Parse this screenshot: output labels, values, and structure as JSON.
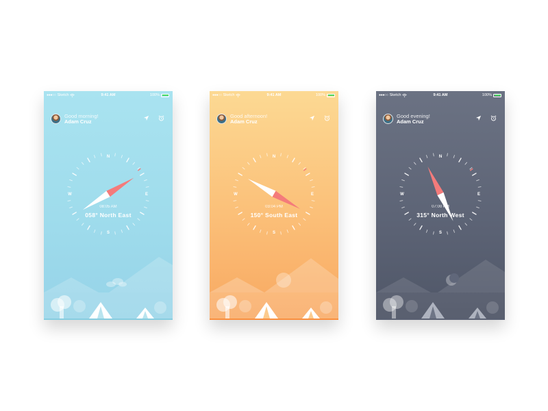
{
  "screens": [
    {
      "theme": "morning",
      "status": {
        "carrier": "Sketch",
        "time": "9:41 AM",
        "battery": "100%"
      },
      "greeting": "Good morning!",
      "user_name": "Adam Cruz",
      "compass": {
        "heading_deg": 58,
        "time": "08:05 AM",
        "heading_text": "058° North East",
        "cardinals": {
          "n": "N",
          "e": "E",
          "s": "S",
          "w": "W"
        }
      },
      "colors": {
        "needle": "#f47b7b",
        "sky_top": "#a9e3f0",
        "sky_bottom": "#96d3e8",
        "ground": "#7ec8dc"
      }
    },
    {
      "theme": "afternoon",
      "status": {
        "carrier": "Sketch",
        "time": "9:41 AM",
        "battery": "100%"
      },
      "greeting": "Good afternoon!",
      "user_name": "Adam Cruz",
      "compass": {
        "heading_deg": 120,
        "time": "03:04 PM",
        "heading_text": "150° South East",
        "cardinals": {
          "n": "N",
          "e": "E",
          "s": "S",
          "w": "W"
        }
      },
      "colors": {
        "needle": "#f47b7b",
        "sky_top": "#fcd993",
        "sky_bottom": "#f8a861",
        "ground": "#fa8f3e"
      }
    },
    {
      "theme": "evening",
      "status": {
        "carrier": "Sketch",
        "time": "9:41 AM",
        "battery": "100%"
      },
      "greeting": "Good evening!",
      "user_name": "Adam Cruz",
      "compass": {
        "heading_deg": 335,
        "time": "07:00 PM",
        "heading_text": "315° North West",
        "cardinals": {
          "n": "N",
          "e": "E",
          "s": "S",
          "w": "W"
        }
      },
      "colors": {
        "needle": "#f47b7b",
        "sky_top": "#6b7283",
        "sky_bottom": "#4f5667",
        "ground": "#5a6173"
      }
    }
  ],
  "icons": {
    "location": "location-arrow-icon",
    "alarm": "alarm-clock-icon",
    "wifi": "wifi-icon",
    "battery": "battery-icon"
  }
}
